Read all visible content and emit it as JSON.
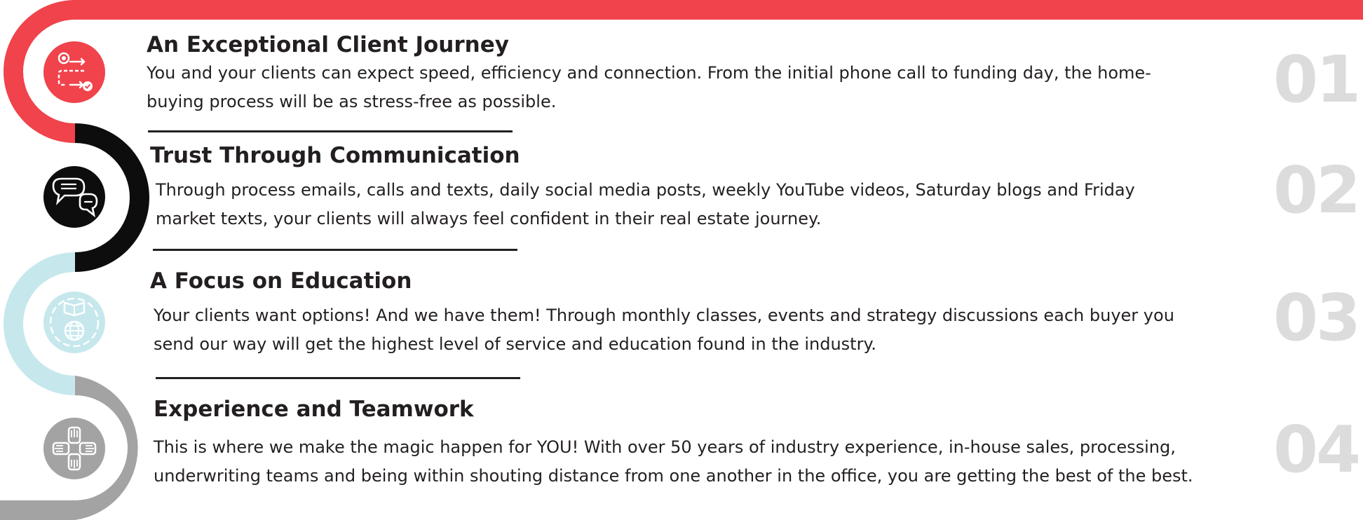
{
  "colors": {
    "red": "#f0434b",
    "black": "#0d0d0d",
    "light_blue": "#c6e8ec",
    "gray": "#a3a3a3",
    "number_gray": "#dcdcdc"
  },
  "steps": [
    {
      "number": "01",
      "title": "An Exceptional Client Journey",
      "body": "You and your clients can expect speed, efficiency and connection. From the initial phone call to funding day, the home-buying process will be as stress-free as possible.",
      "icon": "client-journey-flow-icon",
      "color": "red"
    },
    {
      "number": "02",
      "title": "Trust Through Communication",
      "body": "Through process emails, calls and texts, daily social media posts, weekly YouTube videos, Saturday blogs and Friday market texts, your clients will always feel confident in their real estate journey.",
      "icon": "chat-bubbles-icon",
      "color": "black"
    },
    {
      "number": "03",
      "title": "A Focus on Education",
      "body": "Your clients want options! And we have them! Through monthly classes, events and strategy discussions each buyer you send our way will get the highest level of service and education found in the industry.",
      "icon": "book-globe-icon",
      "color": "light_blue"
    },
    {
      "number": "04",
      "title": "Experience and Teamwork",
      "body": "This is where we make the magic happen for YOU! With over 50 years of industry experience, in-house sales, processing, underwriting teams and being within shouting distance from one another in the office, you are getting the best of the best.",
      "icon": "teamwork-hands-icon",
      "color": "gray"
    }
  ]
}
